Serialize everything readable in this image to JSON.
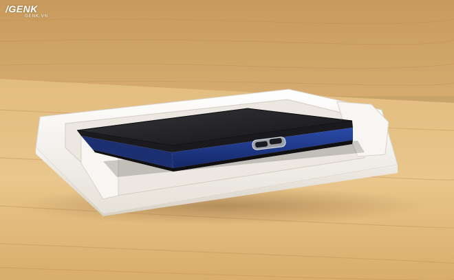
{
  "watermark": {
    "brand": "/GENK",
    "domain": "GENK.VN"
  },
  "colors": {
    "wood_light": "#e8c489",
    "wood_mid": "#d5a868",
    "wood_dark": "#b68447",
    "tray_white": "#f2efea",
    "tray_shadow": "#d9d2c6",
    "drive_black": "#18181c",
    "drive_top": "#26262b",
    "drive_blue": "#1f3b8c",
    "port_silver": "#a8adb4"
  },
  "subject": {
    "items": [
      "wood-table",
      "white-plastic-tray",
      "black-external-drive",
      "usb-3-micro-b-port"
    ]
  }
}
